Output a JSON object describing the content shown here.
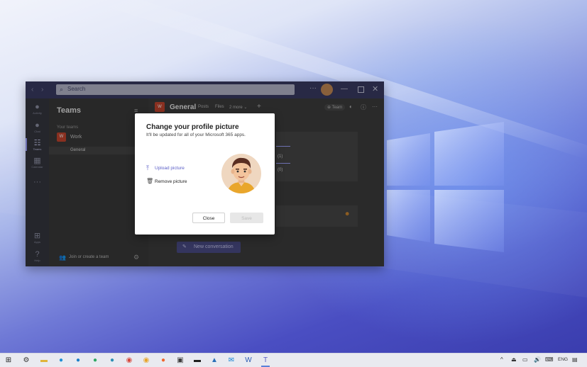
{
  "teams": {
    "search": {
      "placeholder": "Search",
      "icon": "search-icon"
    },
    "titlebar": {
      "more": "···",
      "minimize": "—",
      "close": "✕"
    },
    "rail": [
      {
        "label": "Activity",
        "icon": "bell-icon"
      },
      {
        "label": "Chat",
        "icon": "chat-icon"
      },
      {
        "label": "Teams",
        "icon": "teams-icon",
        "active": true
      },
      {
        "label": "Calendar",
        "icon": "calendar-icon"
      },
      {
        "label": "···",
        "icon": "more-icon"
      },
      {
        "label": "Apps",
        "icon": "apps-icon"
      },
      {
        "label": "Help",
        "icon": "help-icon"
      }
    ],
    "panel": {
      "title": "Teams",
      "section": "Your teams",
      "team": {
        "initials": "W",
        "name": "Work"
      },
      "channel": "General",
      "join": "Join or create a team"
    },
    "main": {
      "tile": "W",
      "title": "General",
      "tabs": [
        "Posts",
        "Files",
        "2 more ⌄"
      ],
      "add_tab": "+",
      "team_badge": "⊕ Team",
      "post_snippet1": "(1)",
      "post_snippet2": "(0)",
      "new_conversation": "New conversation"
    }
  },
  "dialog": {
    "title": "Change your profile picture",
    "subtitle": "It'll be updated for all of your Microsoft 365 apps.",
    "upload_label": "Upload picture",
    "remove_label": "Remove picture",
    "close_label": "Close",
    "save_label": "Save"
  },
  "taskbar": {
    "language": "ENG",
    "apps": [
      "start-icon",
      "settings-icon",
      "file-explorer-icon",
      "edge-icon",
      "edge-beta-icon",
      "edge-dev-icon",
      "edge-canary-icon",
      "chrome-icon",
      "chrome-canary-icon",
      "firefox-icon",
      "terminal-icon",
      "command-prompt-icon",
      "photos-icon",
      "mail-icon",
      "word-icon",
      "teams-icon"
    ]
  }
}
